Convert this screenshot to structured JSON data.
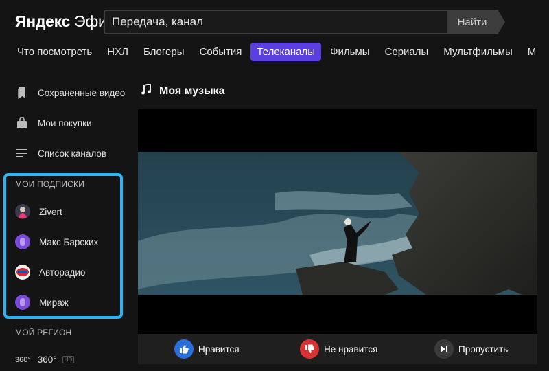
{
  "header": {
    "logo_part1": "Яндекс",
    "logo_part2": "Эфир",
    "search_placeholder": "Передача, канал",
    "search_button": "Найти"
  },
  "nav": {
    "items": [
      "Что посмотреть",
      "НХЛ",
      "Блогеры",
      "События",
      "Телеканалы",
      "Фильмы",
      "Сериалы",
      "Мультфильмы",
      "М"
    ],
    "active": "Телеканалы"
  },
  "sidebar": {
    "links": [
      {
        "label": "Сохраненные видео",
        "icon": "bookmark-icon"
      },
      {
        "label": "Мои покупки",
        "icon": "shopping-bag-icon"
      },
      {
        "label": "Список каналов",
        "icon": "list-icon"
      }
    ],
    "subscriptions_heading": "МОИ ПОДПИСКИ",
    "subscriptions": [
      {
        "label": "Zivert",
        "icon": "zivert-avatar"
      },
      {
        "label": "Макс Барских",
        "icon": "mic-avatar"
      },
      {
        "label": "Авторадио",
        "icon": "autoradio-logo"
      },
      {
        "label": "Мираж",
        "icon": "mic-avatar"
      }
    ],
    "region_heading": "МОЙ РЕГИОН",
    "region": {
      "logo_text": "360°",
      "label": "360°",
      "badge": "HD"
    }
  },
  "main": {
    "title": "Моя музыка",
    "title_icon": "music-note-icon"
  },
  "controls": {
    "like": "Нравится",
    "dislike": "Не нравится",
    "skip": "Пропустить"
  },
  "colors": {
    "accent": "#5c3fe0",
    "highlight_border": "#29b6f6",
    "like": "#2a6fdb",
    "dislike": "#d93434",
    "skip": "#3a3a3a"
  }
}
